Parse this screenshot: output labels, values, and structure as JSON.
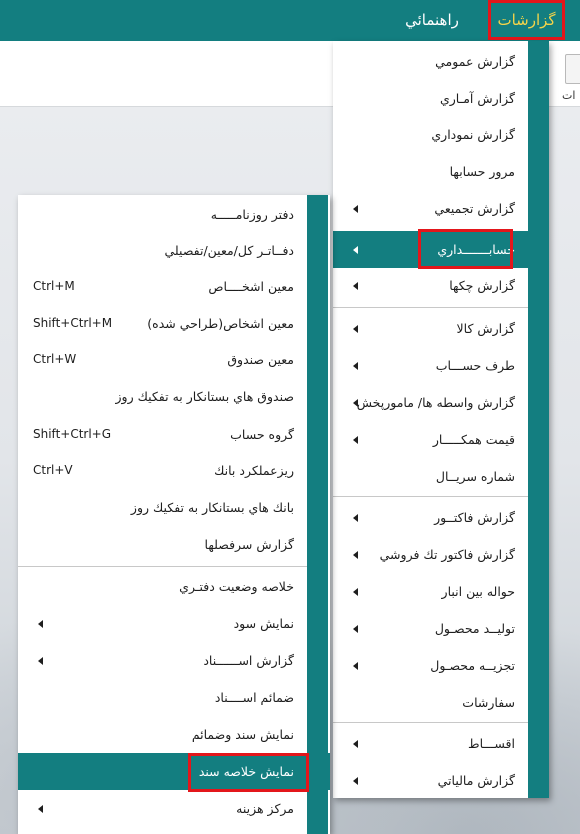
{
  "menubar": {
    "reports": "گزارشات",
    "guide": "راهنمائي"
  },
  "toolbar": {
    "partial_label": "ات"
  },
  "main_menu": {
    "items": [
      {
        "label": "گزارش عمومي",
        "submenu": false
      },
      {
        "label": "گزارش آمـاري",
        "submenu": false
      },
      {
        "label": "گزارش نموداري",
        "submenu": false
      },
      {
        "label": "مرور حسابها",
        "submenu": false
      },
      {
        "label": "گزارش تجميعي",
        "submenu": true
      },
      {
        "label": "حسابـــــــداري",
        "submenu": true,
        "active": true
      },
      {
        "label": "گزارش چكها",
        "submenu": true
      },
      {
        "label": "گزارش كالا",
        "submenu": true
      },
      {
        "label": "طرف حســـاب",
        "submenu": true
      },
      {
        "label": "گزارش واسطه ها/ مامورپخش",
        "submenu": true
      },
      {
        "label": "قيمت همكـــــار",
        "submenu": true
      },
      {
        "label": "شماره سريــال",
        "submenu": false
      },
      {
        "label": "گزارش فاكتــور",
        "submenu": true
      },
      {
        "label": "گزارش فاكتور تك فروشي",
        "submenu": true
      },
      {
        "label": "حواله بين انبار",
        "submenu": true
      },
      {
        "label": "توليــد محصـول",
        "submenu": true
      },
      {
        "label": "تجزيــه محصـول",
        "submenu": true
      },
      {
        "label": "سفارشات",
        "submenu": false
      },
      {
        "label": "اقســـاط",
        "submenu": true
      },
      {
        "label": "گزارش مالياتي",
        "submenu": true
      }
    ]
  },
  "sub_menu": {
    "items": [
      {
        "label": "دفتر روزنامـــــه",
        "shortcut": "",
        "submenu": false
      },
      {
        "label": "دفــاتـر كل/معين/تفصيلي",
        "shortcut": "",
        "submenu": false
      },
      {
        "label": "معين اشخــــاص",
        "shortcut": "Ctrl+M",
        "submenu": false
      },
      {
        "label": "معين اشخاص(طراحي شده)",
        "shortcut": "Shift+Ctrl+M",
        "submenu": false
      },
      {
        "label": "معين صندوق",
        "shortcut": "Ctrl+W",
        "submenu": false
      },
      {
        "label": "صندوق هاي بستانكار به تفكيك روز",
        "shortcut": "",
        "submenu": false
      },
      {
        "label": "گروه حساب",
        "shortcut": "Shift+Ctrl+G",
        "submenu": false
      },
      {
        "label": "ريزعملكرد بانك",
        "shortcut": "Ctrl+V",
        "submenu": false
      },
      {
        "label": "بانك هاي بستانكار به تفكيك روز",
        "shortcut": "",
        "submenu": false
      },
      {
        "label": "گزارش سرفصلها",
        "shortcut": "",
        "submenu": false
      },
      {
        "label": "خلاصه وضعيت دفتـري",
        "shortcut": "",
        "submenu": false
      },
      {
        "label": "نمايش سود",
        "shortcut": "",
        "submenu": true
      },
      {
        "label": "گزارش   اســــــناد",
        "shortcut": "",
        "submenu": true
      },
      {
        "label": "ضمائم اســــناد",
        "shortcut": "",
        "submenu": false
      },
      {
        "label": "نمايش سند وضمائم",
        "shortcut": "",
        "submenu": false
      },
      {
        "label": "نمايش خلاصه سند",
        "shortcut": "",
        "submenu": false,
        "active": true
      },
      {
        "label": "مركز هزينه",
        "shortcut": "",
        "submenu": true
      }
    ]
  },
  "colors": {
    "menubar": "#137e80",
    "reports_text": "#f3d44a",
    "highlight_border": "#e3161b",
    "active_row": "#137e80"
  }
}
